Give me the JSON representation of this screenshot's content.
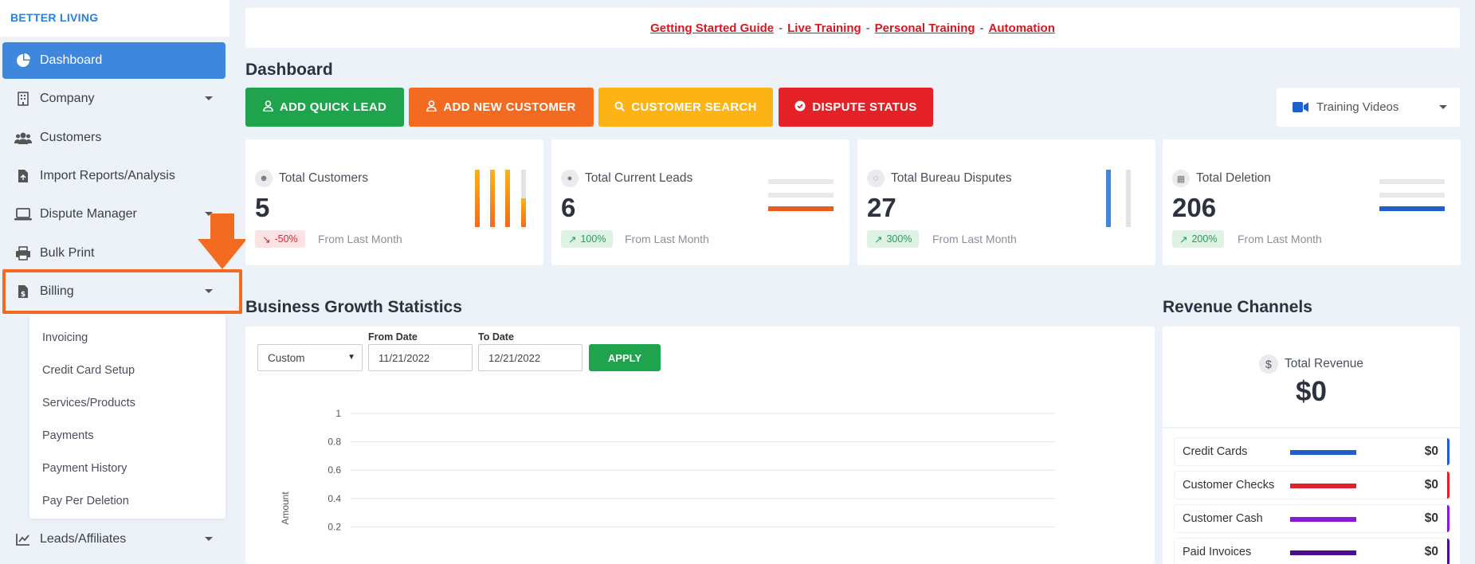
{
  "brand": "BETTER LIVING",
  "sidebar": {
    "items": [
      {
        "label": "Dashboard"
      },
      {
        "label": "Company"
      },
      {
        "label": "Customers"
      },
      {
        "label": "Import Reports/Analysis"
      },
      {
        "label": "Dispute Manager"
      },
      {
        "label": "Bulk Print"
      },
      {
        "label": "Billing"
      },
      {
        "label": "Leads/Affiliates"
      }
    ],
    "billing_submenu": [
      "Invoicing",
      "Credit Card Setup",
      "Services/Products",
      "Payments",
      "Payment History",
      "Pay Per Deletion"
    ]
  },
  "toplinks": {
    "links": [
      "Getting Started Guide",
      "Live Training",
      "Personal Training",
      "Automation"
    ],
    "separator": "-"
  },
  "page_title": "Dashboard",
  "quick_buttons": {
    "add_quick_lead": "ADD QUICK LEAD",
    "add_new_customer": "ADD NEW CUSTOMER",
    "customer_search": "CUSTOMER SEARCH",
    "dispute_status": "DISPUTE STATUS"
  },
  "training_select": "Training Videos",
  "cards": [
    {
      "label": "Total Customers",
      "value": "5",
      "badge": "-50%",
      "from": "From Last Month"
    },
    {
      "label": "Total Current Leads",
      "value": "6",
      "badge": "100%",
      "from": "From Last Month"
    },
    {
      "label": "Total Bureau Disputes",
      "value": "27",
      "badge": "300%",
      "from": "From Last Month"
    },
    {
      "label": "Total Deletion",
      "value": "206",
      "badge": "200%",
      "from": "From Last Month"
    }
  ],
  "growth": {
    "title": "Business Growth Statistics",
    "period": "Custom",
    "from_label": "From Date",
    "from_value": "11/21/2022",
    "to_label": "To Date",
    "to_value": "12/21/2022",
    "apply": "APPLY"
  },
  "chart_data": {
    "type": "line",
    "ylabel": "Amount",
    "ylim": [
      0,
      1
    ],
    "yticks": [
      "1",
      "0.8",
      "0.6",
      "0.4",
      "0.2"
    ],
    "series": []
  },
  "revenue": {
    "title": "Revenue Channels",
    "total_label": "Total Revenue",
    "total_value": "$0",
    "channels": [
      {
        "name": "Credit Cards",
        "amount": "$0",
        "color": "#1f5fcc"
      },
      {
        "name": "Customer Checks",
        "amount": "$0",
        "color": "#e0202a"
      },
      {
        "name": "Customer Cash",
        "amount": "$0",
        "color": "#8a19d6"
      },
      {
        "name": "Paid Invoices",
        "amount": "$0",
        "color": "#4a0f8c"
      }
    ]
  },
  "colors": {
    "primary": "#3f87dc",
    "green": "#1fa34d",
    "orange": "#f26b21",
    "yellow": "#fcb316",
    "red": "#e42127"
  }
}
